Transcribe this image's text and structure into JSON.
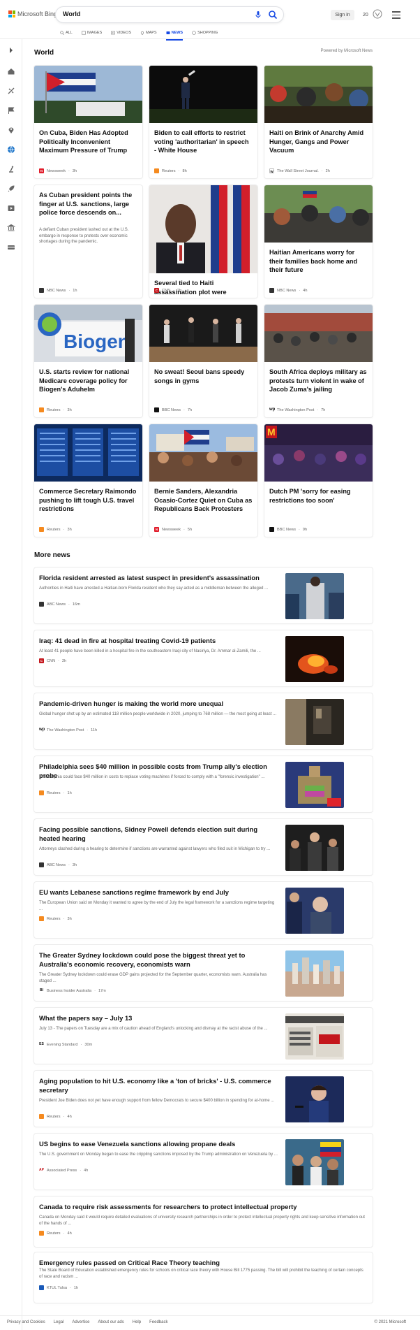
{
  "header": {
    "brand": "Microsoft Bing",
    "query": "World",
    "sign_in": "Sign in",
    "rewards_count": "20",
    "tabs": [
      {
        "label": "ALL",
        "icon": "search-icon"
      },
      {
        "label": "IMAGES",
        "icon": "image-icon"
      },
      {
        "label": "VIDEOS",
        "icon": "video-icon"
      },
      {
        "label": "MAPS",
        "icon": "map-pin-icon"
      },
      {
        "label": "NEWS",
        "icon": "news-icon",
        "active": true
      },
      {
        "label": "SHOPPING",
        "icon": "tag-icon"
      }
    ],
    "accent": "#174ae4"
  },
  "sidebar": {
    "icons": [
      "expand-arrow-icon",
      "home-icon",
      "topics-icon",
      "flag-icon",
      "location-icon",
      "globe-icon",
      "science-icon",
      "rocket-icon",
      "entertainment-icon",
      "bank-icon",
      "money-icon"
    ]
  },
  "world": {
    "title": "World",
    "powered_by": "Powered by Microsoft News",
    "cards": [
      {
        "title": "On Cuba, Biden Has Adopted Politically Inconvenient Maximum Pressure of Trump",
        "provider": "Newsweek",
        "time": "3h"
      },
      {
        "title": "Biden to call efforts to restrict voting 'authoritarian' in speech - White House",
        "provider": "Reuters",
        "time": "8h"
      },
      {
        "title": "Haiti on Brink of Anarchy Amid Hunger, Gangs and Power Vacuum",
        "provider": "The Wall Street Journal.",
        "time": "2h"
      },
      {
        "title": "As Cuban president points the finger at U.S. sanctions, large police force descends on...",
        "snippet": "A defiant Cuban president lashed out at the U.S. embargo in response to protests over economic shortages during the pandemic.",
        "provider": "NBC News",
        "time": "1h"
      },
      {
        "title": "Several tied to Haiti assassination plot were previously US law enforceme...",
        "provider": "CNN",
        "time": "2h"
      },
      {
        "title": "Haitian Americans worry for their families back home and their future",
        "provider": "NBC News",
        "time": "4h"
      },
      {
        "title": "U.S. starts review for national Medicare coverage policy for Biogen's Aduhelm",
        "provider": "Reuters",
        "time": "3h",
        "image_text": "Biogen"
      },
      {
        "title": "No sweat! Seoul bans speedy songs in gyms",
        "provider": "BBC News",
        "time": "7h"
      },
      {
        "title": "South Africa deploys military as protests turn violent in wake of Jacob Zuma's jailing",
        "provider": "The Washington Post",
        "time": "7h"
      },
      {
        "title": "Commerce Secretary Raimondo pushing to lift tough U.S. travel restrictions",
        "provider": "Reuters",
        "time": "3h"
      },
      {
        "title": "Bernie Sanders, Alexandria Ocasio-Cortez Quiet on Cuba as Republicans Back Protesters",
        "provider": "Newsweek",
        "time": "5h"
      },
      {
        "title": "Dutch PM 'sorry for easing restrictions too soon'",
        "provider": "BBC News",
        "time": "9h"
      }
    ]
  },
  "more_news": {
    "title": "More news",
    "items": [
      {
        "title": "Florida resident arrested as latest suspect in president's assassination",
        "snippet": "Authorities in Haiti have arrested a Haitian-born Florida resident who they say acted as a middleman between the alleged ...",
        "provider": "ABC News",
        "time": "16m"
      },
      {
        "title": "Iraq: 41 dead in fire at hospital treating Covid-19 patients",
        "snippet": "At least 41 people have been killed in a hospital fire in the southeastern Iraqi city of Nasiriya, Dr. Ammar al-Zamili, the ...",
        "provider": "CNN",
        "time": "2h"
      },
      {
        "title": "Pandemic-driven hunger is making the world more unequal",
        "snippet": "Global hunger shot up by an estimated 118 million people worldwide in 2020, jumping to 768 million — the most going at least ...",
        "provider": "The Washington Post",
        "time": "11h"
      },
      {
        "title": "Philadelphia sees $40 million in possible costs from Trump ally's election probe",
        "snippet": "Philadelphia could face $40 million in costs to replace voting machines if forced to comply with a \"forensic investigation\" ...",
        "provider": "Reuters",
        "time": "1h"
      },
      {
        "title": "Facing possible sanctions, Sidney Powell defends election suit during heated hearing",
        "snippet": "Attorneys clashed during a hearing to determine if sanctions are warranted against lawyers who filed suit in Michigan to try ...",
        "provider": "ABC News",
        "time": "3h"
      },
      {
        "title": "EU wants Lebanese sanctions regime framework by end July",
        "snippet": "The European Union said on Monday it wanted to agree by the end of July the legal framework for a sanctions regime targeting ...",
        "provider": "Reuters",
        "time": "3h"
      },
      {
        "title": "The Greater Sydney lockdown could pose the biggest threat yet to Australia's economic recovery, economists warn",
        "snippet": "The Greater Sydney lockdown could erase GDP gains projected for the September quarter, economists warn. Australia has staged ...",
        "provider": "Business Insider Australia",
        "time": "17m"
      },
      {
        "title": "What the papers say – July 13",
        "snippet": "July 13 - The papers on Tuesday are a mix of caution ahead of England's unlocking and dismay at the racist abuse of the ...",
        "provider": "Evening Standard",
        "time": "30m"
      },
      {
        "title": "Aging population to hit U.S. economy like a 'ton of bricks' - U.S. commerce secretary",
        "snippet": "President Joe Biden does not yet have enough support from fellow Democrats to secure $400 billion in spending for at-home ...",
        "provider": "Reuters",
        "time": "4h"
      },
      {
        "title": "US begins to ease Venezuela sanctions allowing propane deals",
        "snippet": "The U.S. government on Monday began to ease the crippling sanctions imposed by the Trump administration on Venezuela by ...",
        "provider": "Associated Press",
        "time": "4h"
      },
      {
        "title": "Canada to require risk assessments for researchers to protect intellectual property",
        "snippet": "Canada on Monday said it would require detailed evaluations of university research partnerships in order to protect intellectual property rights and keep sensitive information out of the hands of ...",
        "provider": "Reuters",
        "time": "4h"
      },
      {
        "title": "Emergency rules passed on Critical Race Theory teaching",
        "snippet": "The State Board of Education established emergency rules for schools on critical race theory with House Bill 1775 passing. The bill will prohibit the teaching of certain concepts of race and racism ...",
        "provider": "KTUL Tulsa",
        "time": "1h"
      }
    ]
  },
  "footer": {
    "links": [
      "Privacy and Cookies",
      "Legal",
      "Advertise",
      "About our ads",
      "Help",
      "Feedback"
    ],
    "copyright": "© 2021 Microsoft"
  }
}
